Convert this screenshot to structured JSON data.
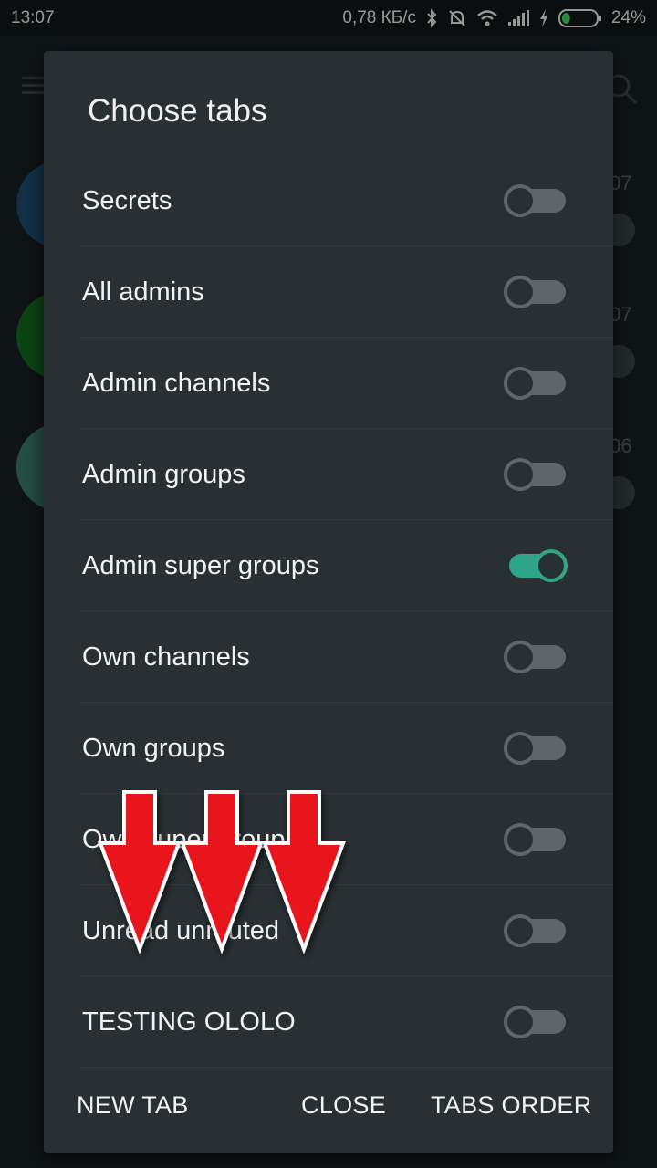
{
  "status_bar": {
    "time": "13:07",
    "network_speed": "0,78 КБ/с",
    "battery_percent": "24%",
    "battery_level": 0.24
  },
  "background_app": {
    "list_times": [
      "07",
      "07",
      "06"
    ]
  },
  "dialog": {
    "title": "Choose tabs",
    "items": [
      {
        "label": "Secrets",
        "enabled": false
      },
      {
        "label": "All admins",
        "enabled": false
      },
      {
        "label": "Admin channels",
        "enabled": false
      },
      {
        "label": "Admin groups",
        "enabled": false
      },
      {
        "label": "Admin super groups",
        "enabled": true
      },
      {
        "label": "Own channels",
        "enabled": false
      },
      {
        "label": "Own groups",
        "enabled": false
      },
      {
        "label": "Own super groups",
        "enabled": false
      },
      {
        "label": "Unread unmuted",
        "enabled": false
      },
      {
        "label": "TESTING OLOLO",
        "enabled": false
      }
    ],
    "actions": {
      "new_tab": "NEW TAB",
      "close": "CLOSE",
      "tabs_order": "TABS ORDER"
    }
  },
  "colors": {
    "accent": "#2fa58a",
    "dialog_bg": "#283033",
    "arrow": "#e8141b"
  },
  "icons": [
    "bluetooth-icon",
    "mute-icon",
    "wifi-icon",
    "signal-icon",
    "charging-icon",
    "battery-icon",
    "menu-icon",
    "search-icon",
    "red-down-arrow-icon"
  ]
}
